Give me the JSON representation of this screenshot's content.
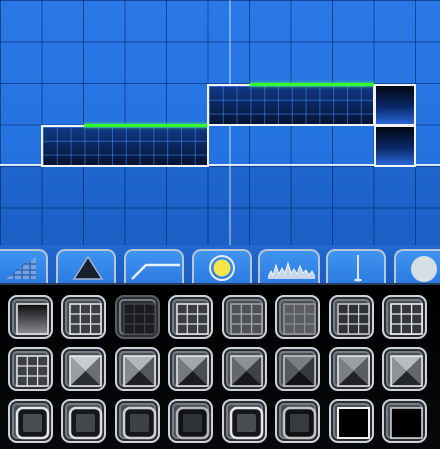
{
  "editor": {
    "tabs": [
      {
        "id": "slopes",
        "icon": "slope-icon"
      },
      {
        "id": "spikes",
        "icon": "spike-icon"
      },
      {
        "id": "ramps",
        "icon": "ramp-icon"
      },
      {
        "id": "orbs",
        "icon": "orb-icon",
        "selected": true
      },
      {
        "id": "ground-spikes",
        "icon": "ground-spikes-icon"
      },
      {
        "id": "rods",
        "icon": "rod-icon"
      },
      {
        "id": "circles",
        "icon": "circle-icon"
      }
    ],
    "palette": [
      {
        "name": "block-gradient"
      },
      {
        "name": "block-grid-3x3"
      },
      {
        "name": "block-grid-dark"
      },
      {
        "name": "block-grid-light"
      },
      {
        "name": "block-grid-plain"
      },
      {
        "name": "block-grid-dim"
      },
      {
        "name": "block-grid-mid"
      },
      {
        "name": "block-grid-bright"
      },
      {
        "name": "block-grid-outline"
      },
      {
        "name": "block-pyramid-1"
      },
      {
        "name": "block-pyramid-2"
      },
      {
        "name": "block-pyramid-3"
      },
      {
        "name": "block-pyramid-4"
      },
      {
        "name": "block-pyramid-5"
      },
      {
        "name": "block-pyramid-6"
      },
      {
        "name": "block-pyramid-7"
      },
      {
        "name": "block-frame-1"
      },
      {
        "name": "block-frame-2"
      },
      {
        "name": "block-frame-3"
      },
      {
        "name": "block-frame-4"
      },
      {
        "name": "block-frame-5"
      },
      {
        "name": "block-frame-6"
      },
      {
        "name": "block-black-1"
      },
      {
        "name": "block-black-2"
      }
    ]
  },
  "colors": {
    "canvas_bg": "#2473e0",
    "edge_glow": "#34ff2c",
    "block_dark": "#0a1e4a",
    "tab_selected_ring": "#ffe34a"
  }
}
